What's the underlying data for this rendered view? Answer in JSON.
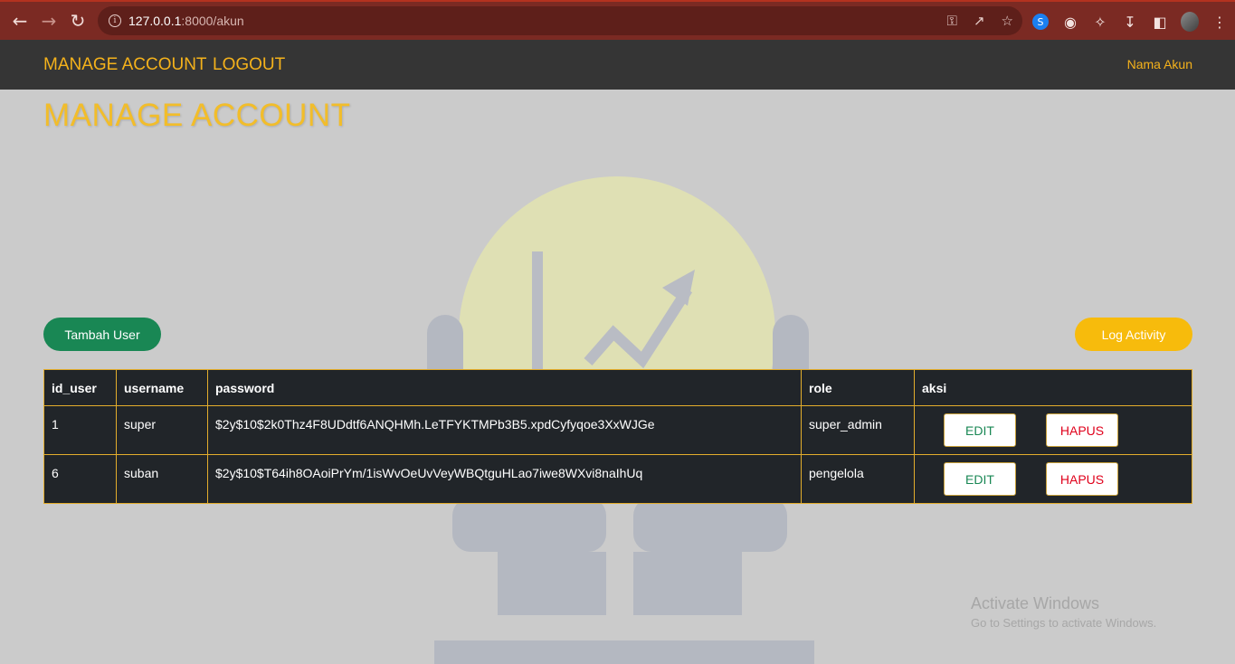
{
  "browser": {
    "url_host": "127.0.0.1",
    "url_path": ":8000/akun",
    "icons": [
      "back-icon",
      "forward-icon",
      "reload-icon",
      "info-icon",
      "key-icon",
      "share-icon",
      "star-icon",
      "shazam-icon",
      "extension-face-icon",
      "puzzle-icon",
      "download-icon",
      "sidebar-icon",
      "avatar",
      "menu-icon"
    ]
  },
  "navbar": {
    "links": [
      "MANAGE ACCOUNT",
      "LOGOUT"
    ],
    "account_name": "Nama Akun"
  },
  "page": {
    "title": "MANAGE ACCOUNT",
    "add_button": "Tambah User",
    "log_button": "Log Activity"
  },
  "table": {
    "headers": [
      "id_user",
      "username",
      "password",
      "role",
      "aksi"
    ],
    "rows": [
      {
        "id_user": "1",
        "username": "super",
        "password": "$2y$10$2k0Thz4F8UDdtf6ANQHMh.LeTFYKTMPb3B5.xpdCyfyqoe3XxWJGe",
        "role": "super_admin",
        "edit": "EDIT",
        "delete": "HAPUS"
      },
      {
        "id_user": "6",
        "username": "suban",
        "password": "$2y$10$T64ih8OAoiPrYm/1isWvOeUvVeyWBQtguHLao7iwe8WXvi8naIhUq",
        "role": "pengelola",
        "edit": "EDIT",
        "delete": "HAPUS"
      }
    ]
  },
  "windows_notice": {
    "line1": "Activate Windows",
    "line2": "Go to Settings to activate Windows."
  },
  "colors": {
    "accent": "#f5b21b",
    "success": "#198754",
    "warning": "#f7bb0c",
    "danger": "#e0001b",
    "table_bg": "#212529"
  }
}
